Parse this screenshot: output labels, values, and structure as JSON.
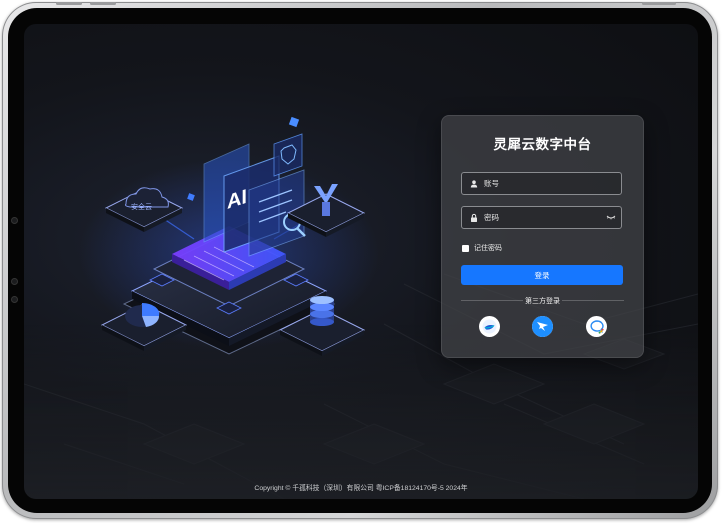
{
  "login": {
    "title": "灵犀云数字中台",
    "username_placeholder": "账号",
    "password_placeholder": "密码",
    "remember_label": "记住密码",
    "submit_label": "登录",
    "third_party_label": "第三方登录",
    "third_party": [
      "feishu-icon",
      "dingtalk-icon",
      "wecom-icon"
    ]
  },
  "illustration": {
    "ai_label": "AI",
    "cloud_label": "安全云"
  },
  "footer": {
    "copyright": "Copyright © 千孤科技（深圳）有限公司 粤ICP备18124170号-5 2024年"
  },
  "colors": {
    "accent": "#1677ff",
    "panel": "#424448",
    "background": "#0d0e11"
  }
}
